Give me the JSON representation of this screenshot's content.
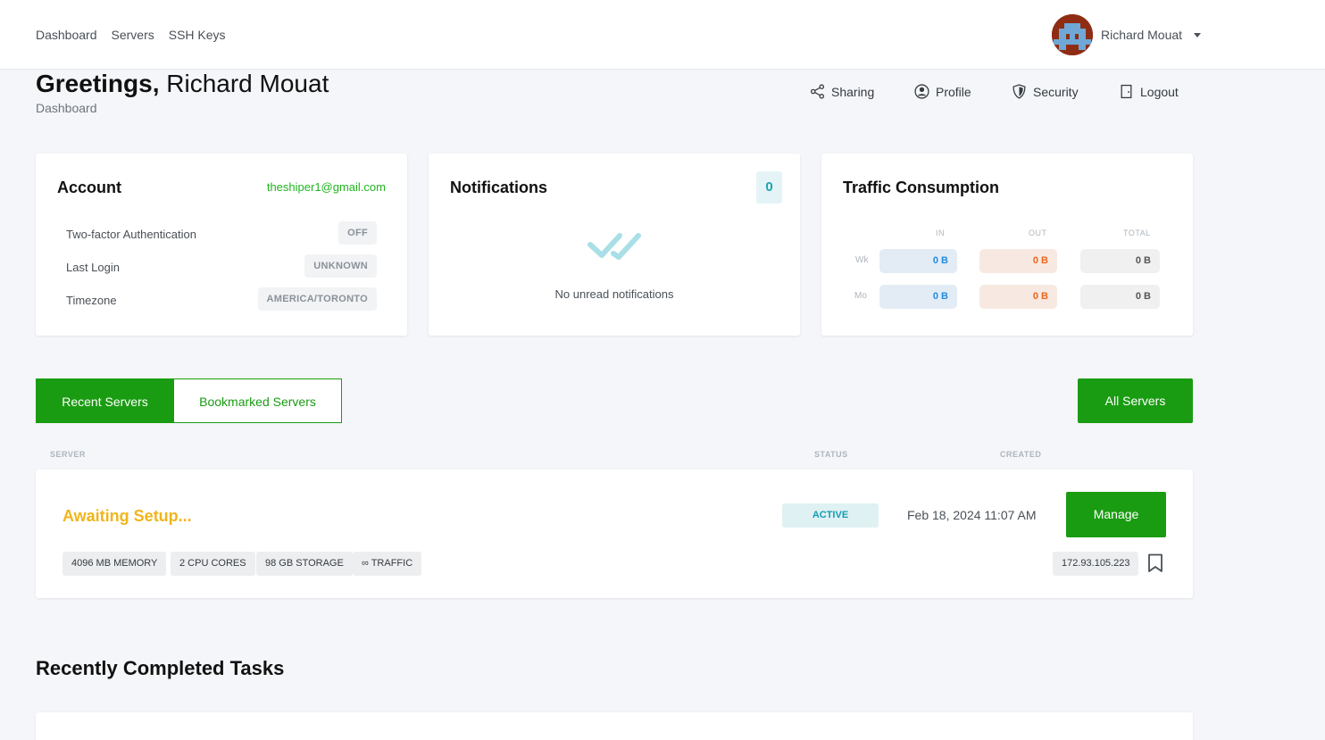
{
  "nav": {
    "links": [
      "Dashboard",
      "Servers",
      "SSH Keys"
    ],
    "user_name": "Richard Mouat"
  },
  "header": {
    "greeting_bold": "Greetings,",
    "greeting_name": "Richard Mouat",
    "subtitle": "Dashboard",
    "actions": {
      "sharing": "Sharing",
      "profile": "Profile",
      "security": "Security",
      "logout": "Logout"
    }
  },
  "account": {
    "title": "Account",
    "email": "theshiper1@gmail.com",
    "rows": [
      {
        "label": "Two-factor Authentication",
        "value": "OFF"
      },
      {
        "label": "Last Login",
        "value": "UNKNOWN"
      },
      {
        "label": "Timezone",
        "value": "AMERICA/TORONTO"
      }
    ]
  },
  "notifications": {
    "title": "Notifications",
    "count": "0",
    "empty_text": "No unread notifications"
  },
  "traffic": {
    "title": "Traffic Consumption",
    "headers": {
      "in": "IN",
      "out": "OUT",
      "total": "TOTAL"
    },
    "rows": [
      {
        "label": "Wk",
        "in": "0 B",
        "out": "0 B",
        "total": "0 B"
      },
      {
        "label": "Mo",
        "in": "0 B",
        "out": "0 B",
        "total": "0 B"
      }
    ]
  },
  "servers": {
    "tabs": {
      "recent": "Recent Servers",
      "bookmarked": "Bookmarked Servers"
    },
    "all_button": "All Servers",
    "columns": {
      "server": "SERVER",
      "status": "STATUS",
      "created": "CREATED"
    },
    "item": {
      "name": "Awaiting Setup...",
      "status": "ACTIVE",
      "created": "Feb 18, 2024 11:07 AM",
      "manage_label": "Manage",
      "specs": {
        "memory": "4096 MB MEMORY",
        "cpu": "2 CPU CORES",
        "storage": "98 GB STORAGE",
        "traffic": "∞ TRAFFIC"
      },
      "ip": "172.93.105.223"
    }
  },
  "tasks": {
    "title": "Recently Completed Tasks"
  },
  "colors": {
    "primary_green": "#1a9c12",
    "warning_yellow": "#f0b51b",
    "info_teal": "#139db2",
    "email_green": "#1fb51f"
  }
}
